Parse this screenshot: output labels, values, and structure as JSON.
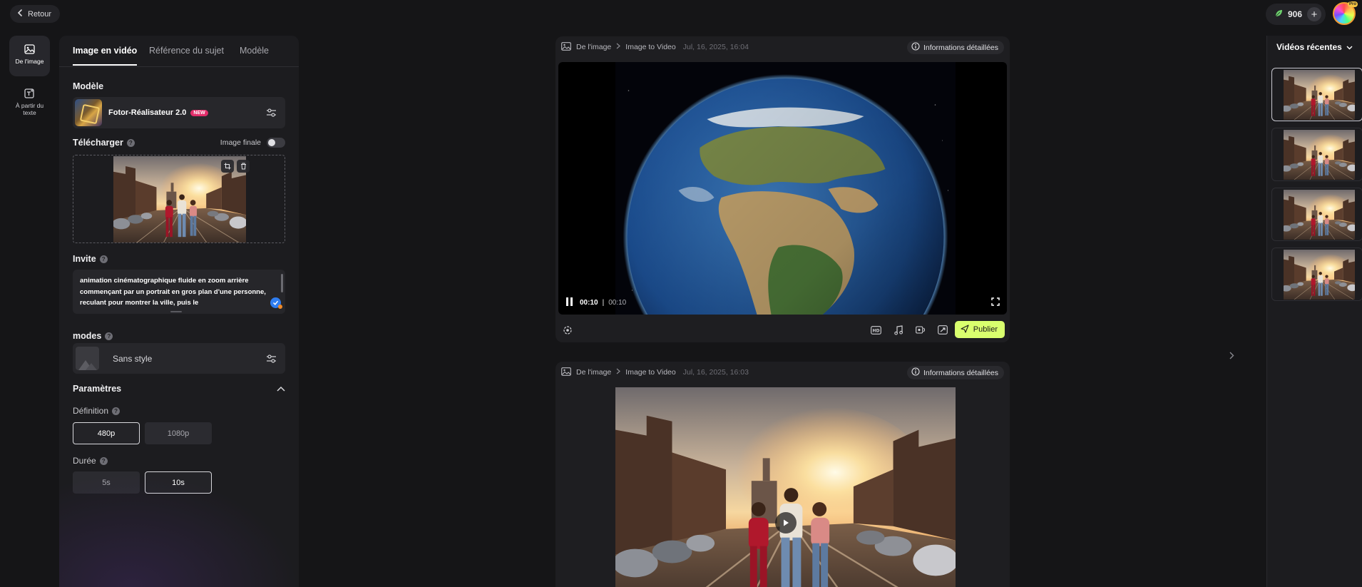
{
  "header": {
    "back_label": "Retour",
    "credits": "906",
    "avatar_badge": "Pro"
  },
  "rail": [
    {
      "label": "De l'image",
      "icon": "image-icon",
      "active": true
    },
    {
      "label": "À partir du texte",
      "icon": "text-to-video-icon",
      "active": false
    }
  ],
  "panel": {
    "tabs": [
      {
        "label": "Image en vidéo",
        "active": true
      },
      {
        "label": "Référence du sujet",
        "active": false
      },
      {
        "label": "Modèle",
        "active": false
      }
    ],
    "model_section": "Modèle",
    "model_name": "Fotor-Réalisateur 2.0",
    "model_badge": "NEW",
    "upload_label": "Télécharger",
    "final_image_label": "Image finale",
    "prompt_label": "Invite",
    "prompt_text": "animation cinématographique fluide en zoom arrière commençant par un portrait en gros plan d'une personne, reculant pour montrer la ville, puis le",
    "modes_label": "modes",
    "style_name": "Sans style",
    "params_label": "Paramètres",
    "definition_label": "Définition",
    "definition_options": [
      "480p",
      "1080p"
    ],
    "definition_selected": "480p",
    "duration_label": "Durée",
    "duration_options": [
      "5s",
      "10s"
    ],
    "duration_selected": "10s"
  },
  "videos": [
    {
      "crumb_source": "De l'image",
      "crumb_type": "Image to Video",
      "timestamp": "Jul, 16, 2025, 16:04",
      "info_label": "Informations détaillées",
      "time_current": "00:10",
      "time_total": "00:10",
      "publish_label": "Publier"
    },
    {
      "crumb_source": "De l'image",
      "crumb_type": "Image to Video",
      "timestamp": "Jul, 16, 2025, 16:03",
      "info_label": "Informations détaillées"
    }
  ],
  "recent": {
    "title": "Vidéos récentes",
    "count": 4
  },
  "colors": {
    "accent_publish": "#d9ff6e",
    "background": "#151517",
    "panel": "#1c1c1f",
    "new_badge": "#e22d6a"
  }
}
